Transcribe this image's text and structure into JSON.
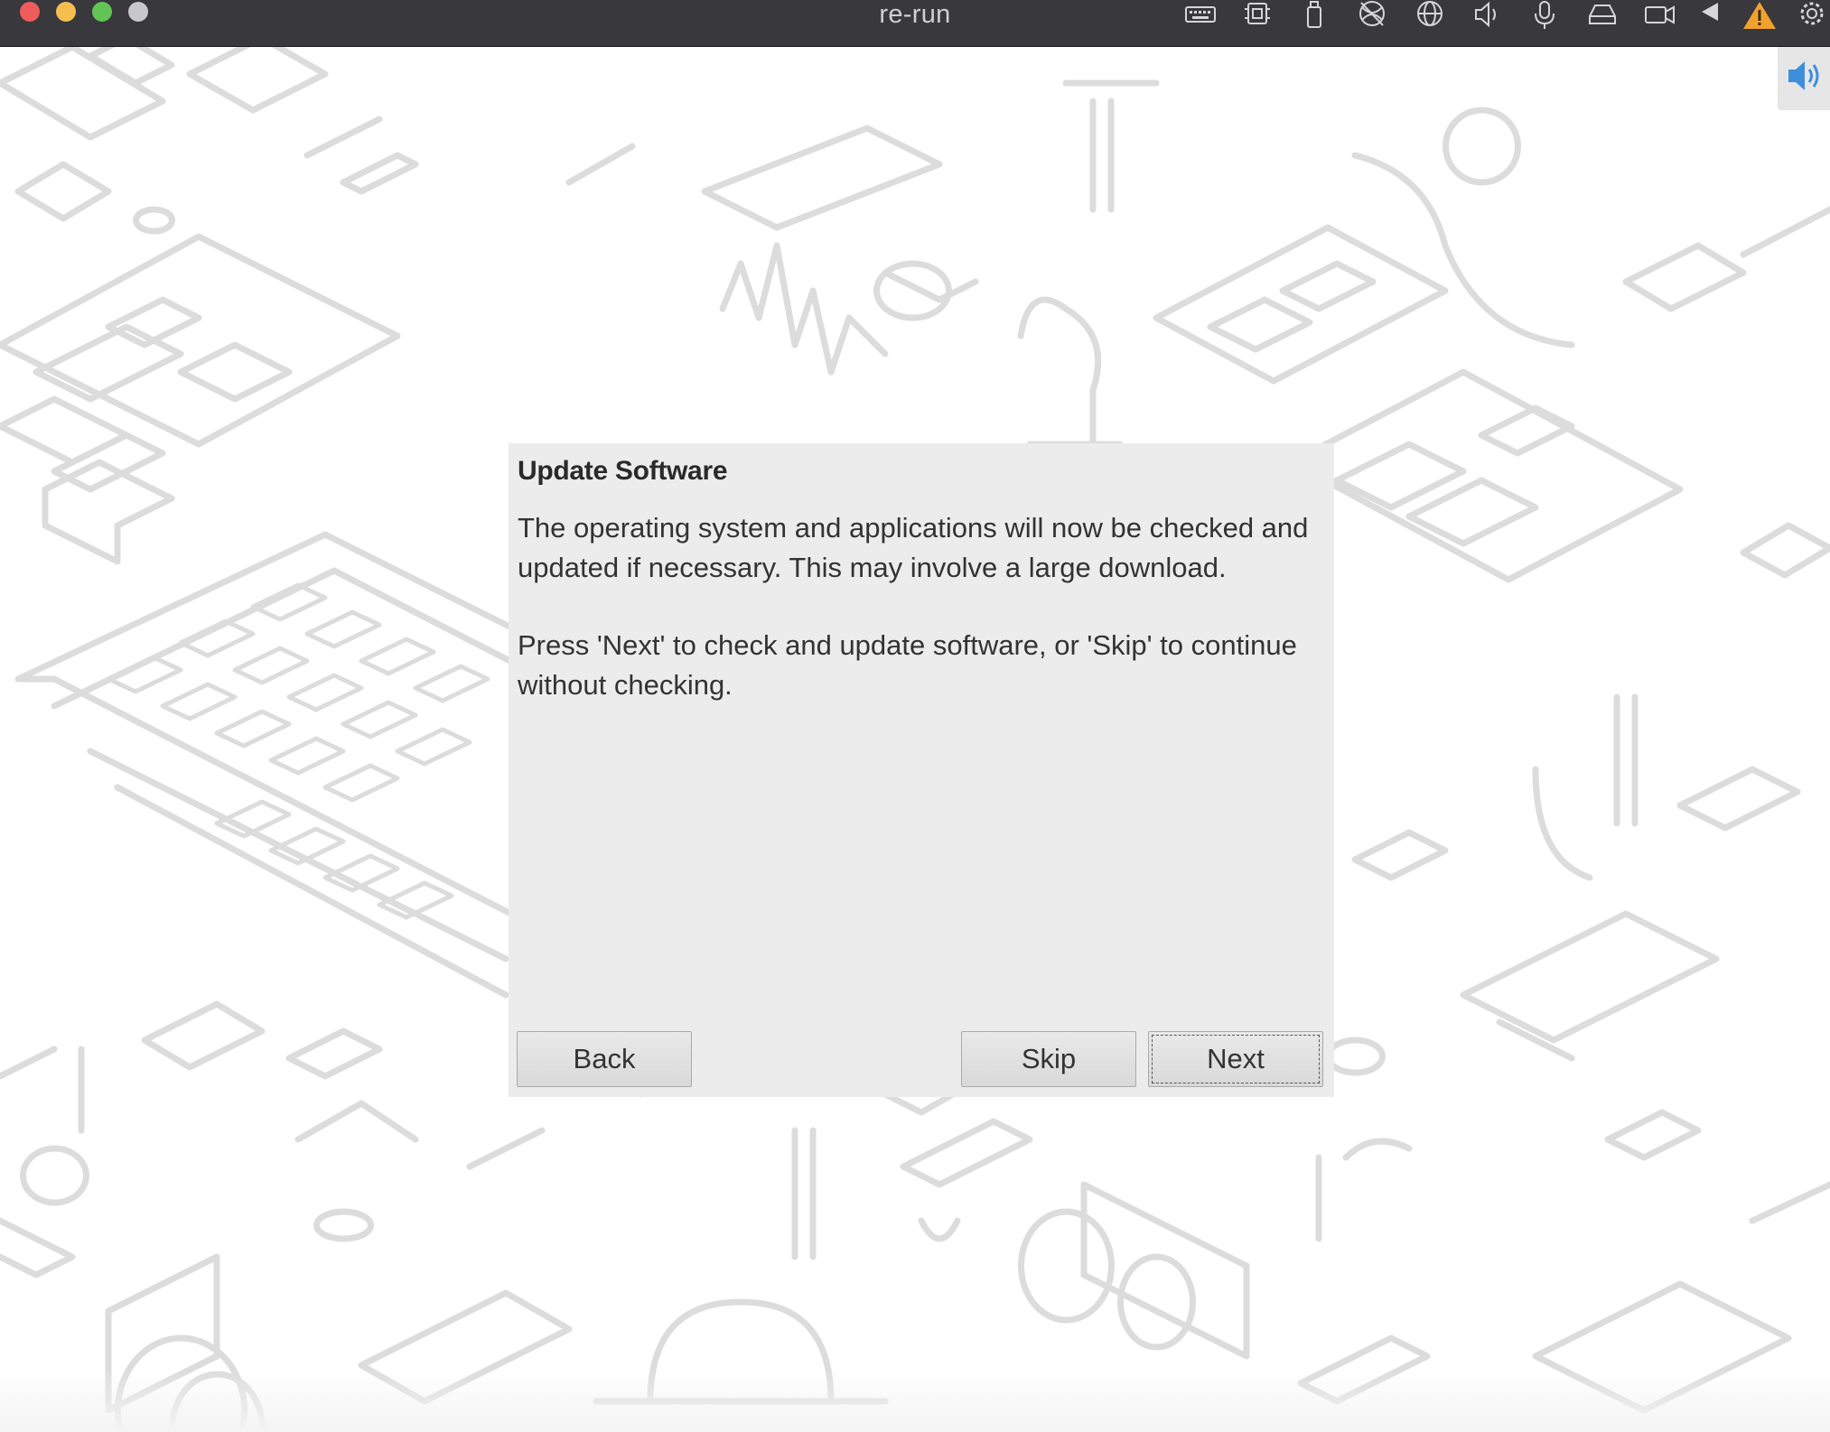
{
  "window": {
    "title": "re-run",
    "traffic_lights": [
      "#ee5d59",
      "#f4bf4f",
      "#61c454",
      "#c8c8cc"
    ],
    "status_icons": [
      "keyboard-icon",
      "cpu-icon",
      "usb-icon",
      "network-disabled-icon",
      "globe-icon",
      "speaker-icon",
      "microphone-icon",
      "disk-icon",
      "camera-icon",
      "play-icon",
      "warning-icon",
      "settings-icon"
    ],
    "warning_color": "#f2a12d"
  },
  "desktop": {
    "volume_icon": "volume-icon",
    "accent": "#3d8fdc"
  },
  "dialog": {
    "title": "Update Software",
    "paragraph1": "The operating system and applications will now be checked and updated if necessary. This may involve a large download.",
    "paragraph2": "Press 'Next' to check and update software, or 'Skip' to continue without checking.",
    "buttons": {
      "back": "Back",
      "skip": "Skip",
      "next": "Next"
    }
  }
}
